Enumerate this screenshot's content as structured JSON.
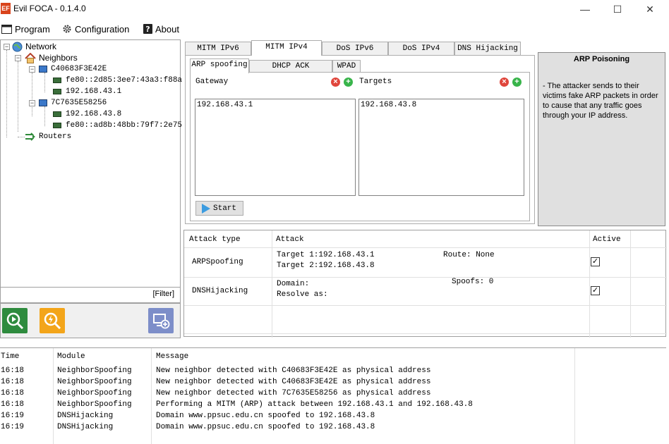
{
  "window": {
    "title": "Evil FOCA - 0.1.4.0",
    "icon_text": "EF",
    "minimize": "—",
    "maximize": "☐",
    "close": "✕"
  },
  "menu": {
    "program": "Program",
    "configuration": "Configuration",
    "about": "About"
  },
  "tree": {
    "root": "Network",
    "neighbors": "Neighbors",
    "hosts": [
      {
        "name": "C40683F3E42E",
        "addresses": [
          "fe80::2d85:3ee7:43a3:f88a",
          "192.168.43.1"
        ]
      },
      {
        "name": "7C7635E58256",
        "addresses": [
          "192.168.43.8",
          "fe80::ad8b:48bb:79f7:2e75"
        ]
      }
    ],
    "routers": "Routers",
    "filter": "[Filter]"
  },
  "tabs": {
    "main": [
      "MITM IPv6",
      "MITM IPv4",
      "DoS IPv6",
      "DoS IPv4",
      "DNS Hijacking"
    ],
    "sub": [
      "ARP spoofing",
      "DHCP ACK Injection",
      "WPAD"
    ]
  },
  "arp": {
    "gateway_label": "Gateway",
    "targets_label": "Targets",
    "gateway_items": [
      "192.168.43.1"
    ],
    "target_items": [
      "192.168.43.8"
    ],
    "start": "Start"
  },
  "description": {
    "title": "ARP Poisoning",
    "text": "- The attacker sends to their victims fake ARP packets in order to cause that any traffic goes through your IP address."
  },
  "attacks": {
    "headers": {
      "type": "Attack type",
      "attack": "Attack",
      "active": "Active"
    },
    "rows": [
      {
        "type": "ARPSpoofing",
        "line1": "Target 1:192.168.43.1",
        "line2": "Target 2:192.168.43.8",
        "extra": "Route: None",
        "active": "✓"
      },
      {
        "type": "DNSHijacking",
        "line1": "Domain:",
        "line2": "Resolve as:",
        "extra": "Spoofs: 0",
        "active": "✓"
      }
    ]
  },
  "log": {
    "headers": {
      "time": "Time",
      "module": "Module",
      "message": "Message"
    },
    "rows": [
      {
        "time": "16:18",
        "module": "NeighborSpoofing",
        "message": "New neighbor detected with C40683F3E42E as physical address"
      },
      {
        "time": "16:18",
        "module": "NeighborSpoofing",
        "message": "New neighbor detected with C40683F3E42E as physical address"
      },
      {
        "time": "16:18",
        "module": "NeighborSpoofing",
        "message": "New neighbor detected with 7C7635E58256 as physical address"
      },
      {
        "time": "16:18",
        "module": "NeighborSpoofing",
        "message": "Performing a MITM (ARP) attack between 192.168.43.1 and 192.168.43.8"
      },
      {
        "time": "16:19",
        "module": "DNSHijacking",
        "message": "Domain www.ppsuc.edu.cn spoofed to 192.168.43.8"
      },
      {
        "time": "16:19",
        "module": "DNSHijacking",
        "message": "Domain www.ppsuc.edu.cn spoofed to 192.168.43.8"
      }
    ]
  }
}
